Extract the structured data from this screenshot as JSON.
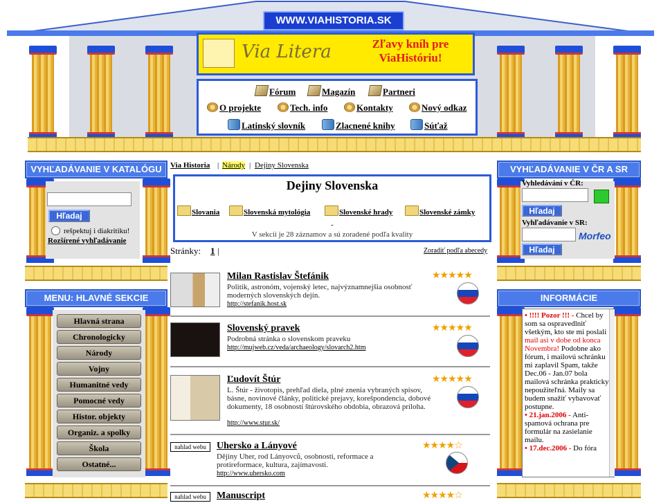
{
  "site": {
    "badge": "WWW.VIAHISTORIA.SK",
    "banner_logo_text": "Via Litera",
    "banner_promo": "Zľavy kníh pre ViaHistóriu!"
  },
  "nav": {
    "forum": "Fórum",
    "magazin": "Magazín",
    "partneri": "Partneri",
    "o_projekte": "O projekte",
    "tech_info": "Tech. info",
    "kontakty": "Kontakty",
    "novy_odkaz": "Nový odkaz",
    "latinsky": "Latinský slovník",
    "zlacnene": "Zlacnené knihy",
    "sutaz": "Súťaž"
  },
  "left_search": {
    "header": "VYHĽADÁVANIE V KATALÓGU",
    "button": "Hľadaj",
    "diacritics": "rešpektuj i diakritiku!",
    "advanced": "Rozšírené vyhľadávanie"
  },
  "menu": {
    "header": "MENU: HLAVNÉ SEKCIE",
    "items": [
      "Hlavná strana",
      "Chronologicky",
      "Národy",
      "Vojny",
      "Humanitné vedy",
      "Pomocné vedy",
      "Histor. objekty",
      "Organiz. a spolky",
      "Škola",
      "Ostatné..."
    ]
  },
  "breadcrumb": {
    "a": "Via Historia",
    "b": "Národy",
    "c": "Dejiny Slovenska"
  },
  "section": {
    "title": "Dejiny Slovenska",
    "folders": [
      "Slovania",
      "Slovenská mytológia",
      "Slovenské hrady",
      "Slovenské zámky"
    ],
    "dash": "-",
    "summary": "V sekcii je 28 záznamov a sú zoradené podľa kvality"
  },
  "pager": {
    "label": "Stránky:",
    "page": "1",
    "sep": "|",
    "sort": "Zoradiť podľa abecedy"
  },
  "entries": [
    {
      "title": "Milan Rastislav Štefánik",
      "desc": "Politik, astronóm, vojenský letec, najvýznamnejšia osobnosť moderných slovenských dejín.",
      "url": "http://stefanik.host.sk",
      "stars": "★★★★★",
      "flag": "SK"
    },
    {
      "title": "Slovenský pravek",
      "desc": "Podrobná stránka o slovenskom praveku",
      "url": "http://mujweb.cz/veda/archaeology/slovarch2.htm",
      "stars": "★★★★★",
      "flag": "SK"
    },
    {
      "title": "Ľudovít Štúr",
      "desc": "L. Štúr - životopis, prehľad diela, plné znenia vybraných spisov, básne, novinové články, politické prejavy, korešpondencia, dobové dokumenty, 18 osobností štúrovského obdobia, obrazová príloha.",
      "url": "http://www.stur.sk/",
      "stars": "★★★★★",
      "flag": "SK"
    },
    {
      "title": "Uhersko a Lányové",
      "desc": "Dějiny Uher, rod Lányovců, osobnosti, reformace a protireformace, kultura, zajímavosti.",
      "url": "http://www.uhersko.com",
      "stars": "★★★★☆",
      "flag": "CZ",
      "web_btn": "nahlad webu"
    },
    {
      "title": "Manuscript",
      "stars": "★★★★☆",
      "web_btn": "nahlad webu"
    }
  ],
  "right_search": {
    "header": "VYHĽADÁVANIE V ČR A SR",
    "cr_label": "Vyhledávání v ČR:",
    "cr_button": "Hľadaj",
    "sr_label": "Vyhľadávanie v SR:",
    "sr_button": "Hľadaj",
    "morfeo": "Morfeo"
  },
  "info": {
    "header": "INFORMÁCIE",
    "b1": "• !!!! Pozor !!! -",
    "t1": " Chcel by som sa ospravedlniť všetkým, kto ste mi poslali ",
    "t1red": "mail asi v dobe od konca Novembra!",
    "t1b": " Podobne ako fórum, i mailovú schránku mi zaplavil Spam, takže Dec.06 - Jan.07 bola mailová schránka prakticky nepoužiteľná. Maily sa budem snažiť vybavovať postupne.",
    "b2": "• 21.jan.2006 -",
    "t2": " Anti-spamová ochrana pre formulár na zasielanie mailu.",
    "b3": "• 17.dec.2006 -",
    "t3": " Do fóra"
  },
  "colors": {
    "accent_blue": "#2c5ad9",
    "gold": "#f3d66b",
    "red": "#e00000"
  }
}
